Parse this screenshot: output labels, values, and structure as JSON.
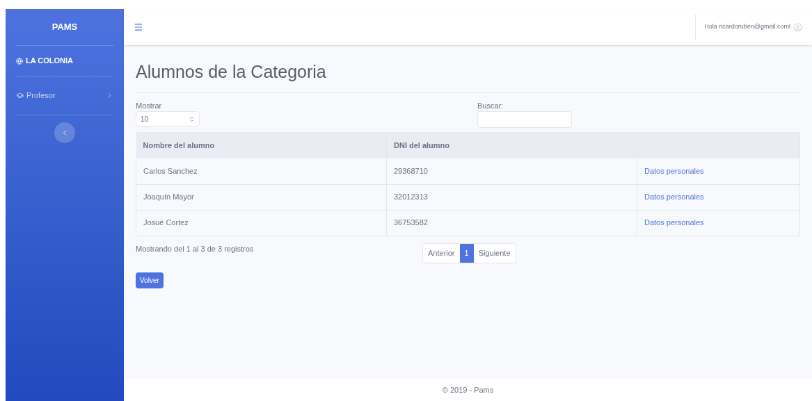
{
  "sidebar": {
    "brand": "PAMS",
    "section": "LA COLONIA",
    "items": [
      {
        "label": "Profesor",
        "expanded": false
      }
    ]
  },
  "topbar": {
    "greeting": "Hola ricardoruben@gmail.coml"
  },
  "page": {
    "title": "Alumnos de la Categoria",
    "length": {
      "label": "Mostrar",
      "value": "10"
    },
    "search": {
      "label": "Buscar:"
    },
    "table": {
      "columns": [
        "Nombre del alumno",
        "DNI del alumno"
      ],
      "rows": [
        {
          "name": "Carlos Sanchez",
          "dni": "29368710",
          "link": "Datos personales"
        },
        {
          "name": "Joaquín Mayor",
          "dni": "32012313",
          "link": "Datos personales"
        },
        {
          "name": "Josué Cortez",
          "dni": "36753582",
          "link": "Datos personales"
        }
      ]
    },
    "info": "Mostrando del 1 al 3 de 3 registros",
    "pagination": [
      {
        "label": "Anterior",
        "selected": false
      },
      {
        "label": "1",
        "selected": true
      },
      {
        "label": "Siguiente",
        "selected": false
      }
    ],
    "back_button": "Volver"
  },
  "footer": "© 2019 - Pams"
}
